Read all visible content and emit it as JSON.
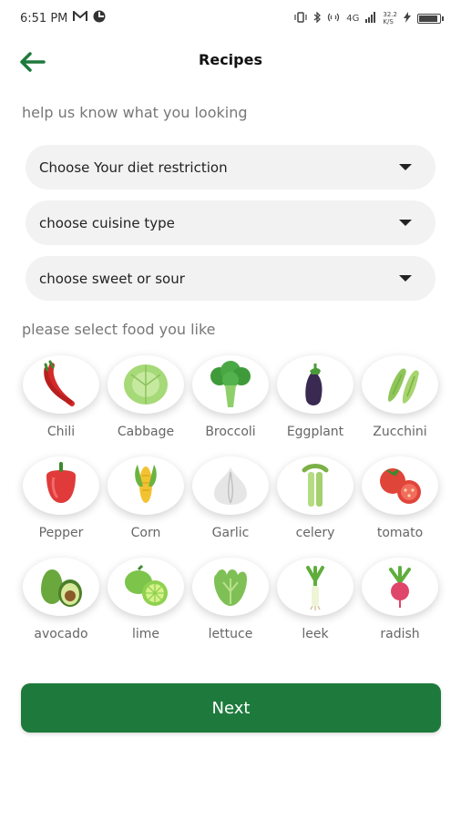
{
  "status_bar": {
    "time": "6:51 PM",
    "signal_text": "4G",
    "speed": "32.2",
    "speed_unit": "K/S"
  },
  "header": {
    "title": "Recipes"
  },
  "prompt": "help us know what you looking",
  "dropdowns": [
    {
      "label": "Choose Your diet restriction"
    },
    {
      "label": "choose cuisine type"
    },
    {
      "label": "choose sweet or sour"
    }
  ],
  "food_prompt": "please select food you like",
  "foods": [
    {
      "label": "Chili",
      "icon": "chili-icon"
    },
    {
      "label": "Cabbage",
      "icon": "cabbage-icon"
    },
    {
      "label": "Broccoli",
      "icon": "broccoli-icon"
    },
    {
      "label": "Eggplant",
      "icon": "eggplant-icon"
    },
    {
      "label": "Zucchini",
      "icon": "zucchini-icon"
    },
    {
      "label": "Pepper",
      "icon": "pepper-icon"
    },
    {
      "label": "Corn",
      "icon": "corn-icon"
    },
    {
      "label": "Garlic",
      "icon": "garlic-icon"
    },
    {
      "label": "celery",
      "icon": "celery-icon"
    },
    {
      "label": "tomato",
      "icon": "tomato-icon"
    },
    {
      "label": "avocado",
      "icon": "avocado-icon"
    },
    {
      "label": "lime",
      "icon": "lime-icon"
    },
    {
      "label": "lettuce",
      "icon": "lettuce-icon"
    },
    {
      "label": "leek",
      "icon": "leek-icon"
    },
    {
      "label": "radish",
      "icon": "radish-icon"
    }
  ],
  "next_button": "Next",
  "colors": {
    "accent": "#1e7a3c",
    "dropdown_bg": "#f2f2f2",
    "muted_text": "#777777"
  }
}
